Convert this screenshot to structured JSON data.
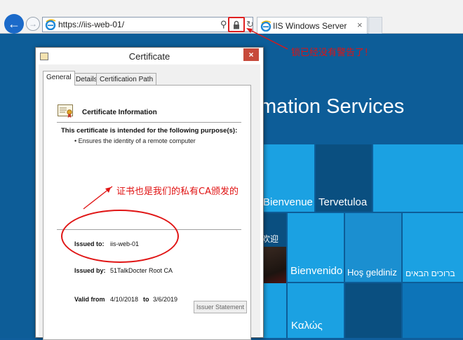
{
  "browser": {
    "back_icon": "back-arrow-icon",
    "forward_icon": "forward-arrow-icon",
    "url": "https://iis-web-01/",
    "tab_title": "IIS Windows Server",
    "tab_close": "×"
  },
  "annotations": {
    "lock_note": "锁已经没有警告了！",
    "ca_note": "证书也是我们的私有CA颁发的"
  },
  "iis_page": {
    "title_fragment": "mation Services",
    "tiles": {
      "bienvenue": "Bienvenue",
      "tervetuloa": "Tervetuloa",
      "huanying": "欢迎",
      "bienvenido": "Bienvenido",
      "hos_geldiniz": "Hoş geldiniz",
      "hebrew": "ברוכים הבאים",
      "kalos": "Καλώς"
    }
  },
  "certificate_dialog": {
    "title": "Certificate",
    "close_label": "×",
    "tabs": [
      "General",
      "Details",
      "Certification Path"
    ],
    "info_title": "Certificate Information",
    "purpose_heading": "This certificate is intended for the following purpose(s):",
    "purpose_item": "• Ensures the identity of a remote computer",
    "issued_to_label": "Issued to:",
    "issued_to_value": "iis-web-01",
    "issued_by_label": "Issued by:",
    "issued_by_value": "51TalkDocter Root CA",
    "valid_from_label": "Valid from",
    "valid_from_value": "4/10/2018",
    "valid_to_label": "to",
    "valid_to_value": "3/6/2019",
    "issuer_statement_button": "Issuer Statement"
  },
  "colors": {
    "accent_red": "#e01212",
    "ie_blue": "#1b6ac9",
    "tile_dark": "#0a4f80",
    "tile_light": "#1ba1e2"
  }
}
